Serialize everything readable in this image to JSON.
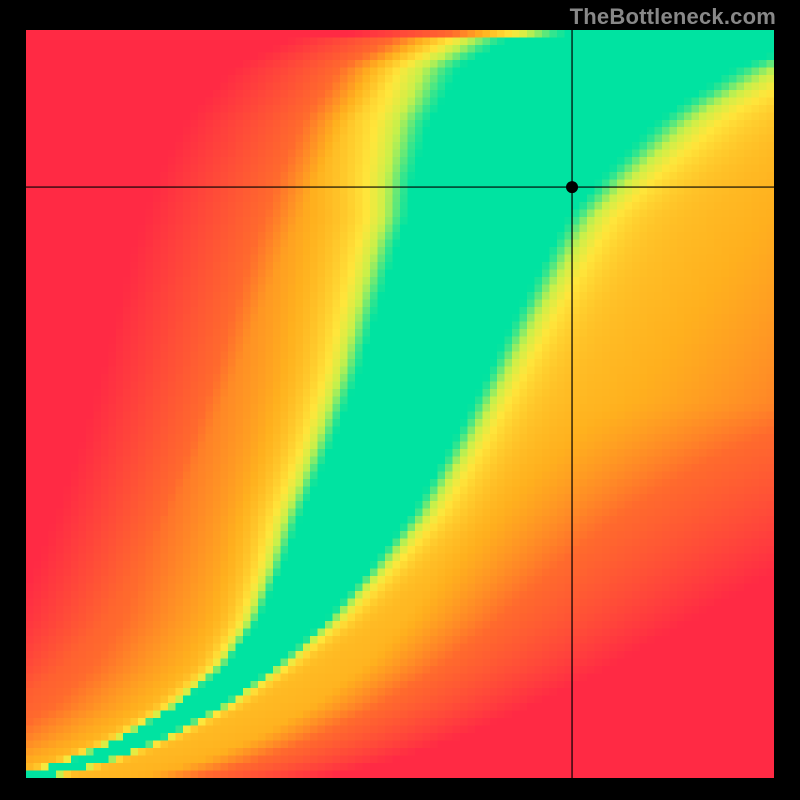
{
  "attribution": "TheBottleneck.com",
  "colors": {
    "background": "#000000",
    "attribution_text": "#888888",
    "crosshair": "#000000",
    "marker_fill": "#000000"
  },
  "chart_data": {
    "type": "heatmap",
    "title": "",
    "xlabel": "",
    "ylabel": "",
    "xlim": [
      0,
      1
    ],
    "ylim": [
      0,
      1
    ],
    "color_scale": {
      "stops": [
        {
          "value": 0.0,
          "color": "#ff2a44"
        },
        {
          "value": 0.4,
          "color": "#ff6a2d"
        },
        {
          "value": 0.55,
          "color": "#ffb01e"
        },
        {
          "value": 0.72,
          "color": "#ffe63b"
        },
        {
          "value": 0.82,
          "color": "#c9f04a"
        },
        {
          "value": 0.93,
          "color": "#36e58d"
        },
        {
          "value": 1.0,
          "color": "#00e3a1"
        }
      ],
      "meaning": "low → high compatibility"
    },
    "ridge": {
      "description": "Approximate green optimal-balance ridge center (normalized x,y)",
      "points": [
        [
          0.0,
          0.0
        ],
        [
          0.075,
          0.02
        ],
        [
          0.15,
          0.05
        ],
        [
          0.23,
          0.095
        ],
        [
          0.3,
          0.15
        ],
        [
          0.355,
          0.21
        ],
        [
          0.4,
          0.28
        ],
        [
          0.445,
          0.36
        ],
        [
          0.49,
          0.45
        ],
        [
          0.53,
          0.54
        ],
        [
          0.565,
          0.63
        ],
        [
          0.6,
          0.715
        ],
        [
          0.64,
          0.8
        ],
        [
          0.69,
          0.88
        ],
        [
          0.76,
          0.95
        ],
        [
          0.85,
          0.99
        ],
        [
          1.0,
          1.0
        ]
      ],
      "width_profile": [
        [
          0.0,
          0.015
        ],
        [
          0.15,
          0.025
        ],
        [
          0.35,
          0.055
        ],
        [
          0.55,
          0.065
        ],
        [
          0.75,
          0.08
        ],
        [
          0.9,
          0.12
        ],
        [
          1.0,
          0.16
        ]
      ]
    },
    "marker": {
      "x": 0.73,
      "y": 0.79,
      "radius_px": 6
    },
    "grid_resolution": 100
  }
}
